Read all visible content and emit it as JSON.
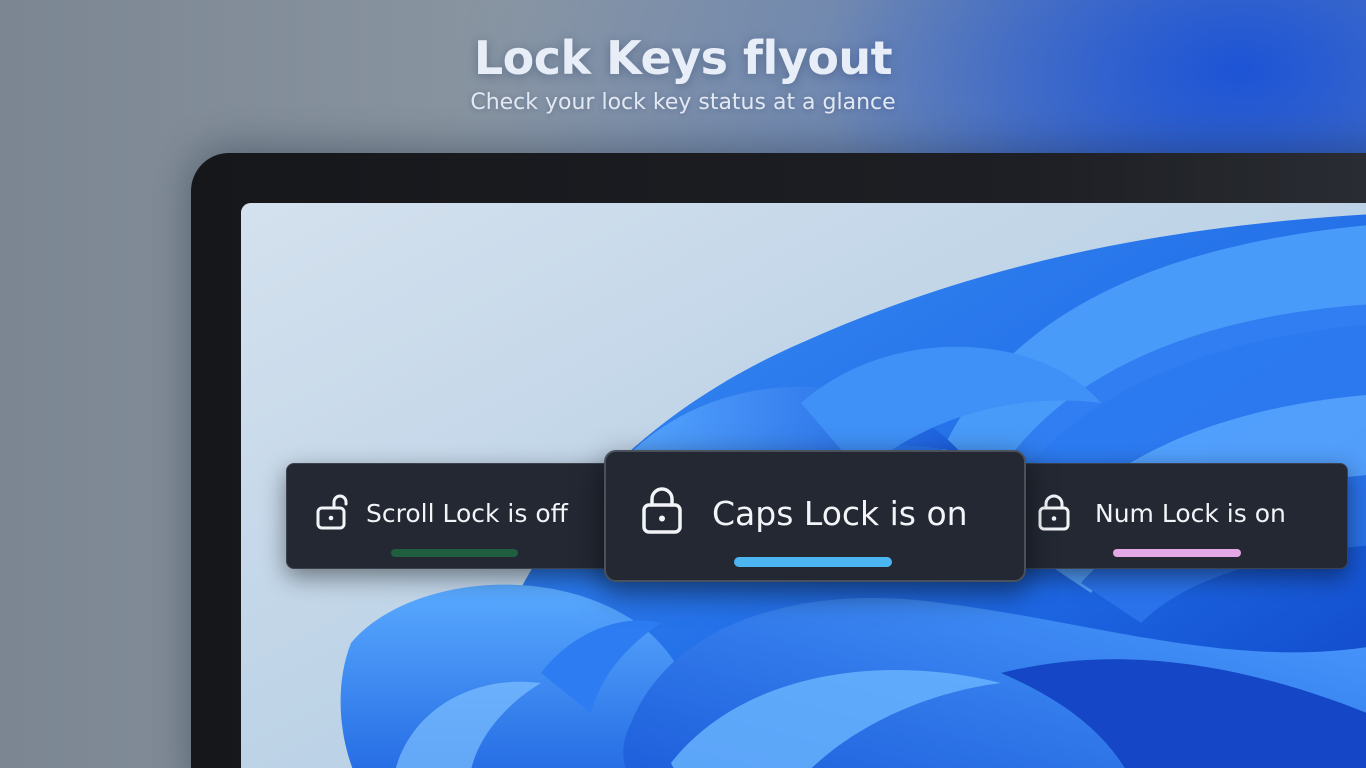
{
  "header": {
    "title": "Lock Keys flyout",
    "subtitle": "Check your lock key status at a glance"
  },
  "flyouts": {
    "scroll_lock": {
      "label": "Scroll Lock is off",
      "state": "unlocked",
      "icon": "lock-open-icon",
      "accent_color": "#1f5e3f"
    },
    "caps_lock": {
      "label": "Caps Lock is on",
      "state": "locked",
      "icon": "lock-closed-icon",
      "accent_color": "#4cb6f2"
    },
    "num_lock": {
      "label": "Num Lock is on",
      "state": "locked",
      "icon": "lock-closed-icon",
      "accent_color": "#e5a8e6"
    }
  },
  "colors": {
    "flyout_bg": "#232833",
    "text": "#f2f4f8",
    "bezel": "#1a1c20"
  }
}
